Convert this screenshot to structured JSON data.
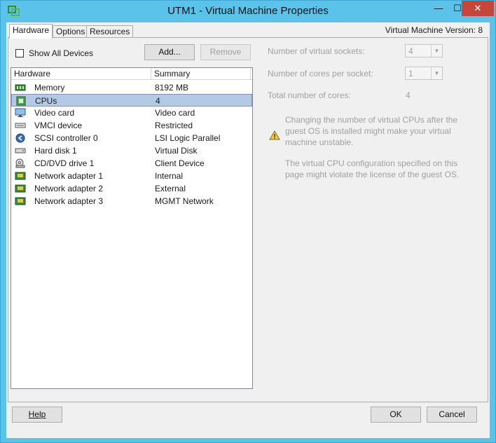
{
  "window": {
    "title": "UTM1 - Virtual Machine Properties",
    "minimize_glyph": "—",
    "maximize_glyph": "☐",
    "close_glyph": "✕"
  },
  "tabs": [
    {
      "label": "Hardware",
      "active": true
    },
    {
      "label": "Options",
      "active": false
    },
    {
      "label": "Resources",
      "active": false
    }
  ],
  "vm_version": "Virtual Machine Version: 8",
  "hardware": {
    "show_all_devices": {
      "label": "Show All Devices",
      "checked": false
    },
    "add_label": "Add...",
    "remove_label": "Remove",
    "columns": [
      "Hardware",
      "Summary"
    ],
    "items": [
      {
        "icon": "memory-icon",
        "name": "Memory",
        "summary": "8192 MB",
        "selected": false
      },
      {
        "icon": "cpu-icon",
        "name": "CPUs",
        "summary": "4",
        "selected": true
      },
      {
        "icon": "monitor-icon",
        "name": "Video card",
        "summary": "Video card",
        "selected": false
      },
      {
        "icon": "vmci-device-icon",
        "name": "VMCI device",
        "summary": "Restricted",
        "selected": false
      },
      {
        "icon": "scsi-controller-icon",
        "name": "SCSI controller 0",
        "summary": "LSI Logic Parallel",
        "selected": false
      },
      {
        "icon": "hard-disk-icon",
        "name": "Hard disk 1",
        "summary": "Virtual Disk",
        "selected": false
      },
      {
        "icon": "cd-dvd-drive-icon",
        "name": "CD/DVD drive 1",
        "summary": "Client Device",
        "selected": false
      },
      {
        "icon": "network-adapter-icon",
        "name": "Network adapter 1",
        "summary": "Internal",
        "selected": false
      },
      {
        "icon": "network-adapter-icon",
        "name": "Network adapter 2",
        "summary": "External",
        "selected": false
      },
      {
        "icon": "network-adapter-icon",
        "name": "Network adapter 3",
        "summary": "MGMT Network",
        "selected": false
      }
    ]
  },
  "cpu_settings": {
    "sockets_label": "Number of virtual sockets:",
    "sockets_value": "4",
    "cores_label": "Number of cores per socket:",
    "cores_value": "1",
    "total_label": "Total number of cores:",
    "total_value": "4",
    "warning": "Changing the number of virtual CPUs after the guest OS is installed might make your virtual machine unstable.",
    "license_note": "The virtual CPU configuration specified on this page might violate the license of the guest OS."
  },
  "footer": {
    "help_label": "Help",
    "ok_label": "OK",
    "cancel_label": "Cancel"
  },
  "colors": {
    "window_frame": "#5bc3ea",
    "selection": "#b3c9e4",
    "close_button": "#c7463b"
  }
}
